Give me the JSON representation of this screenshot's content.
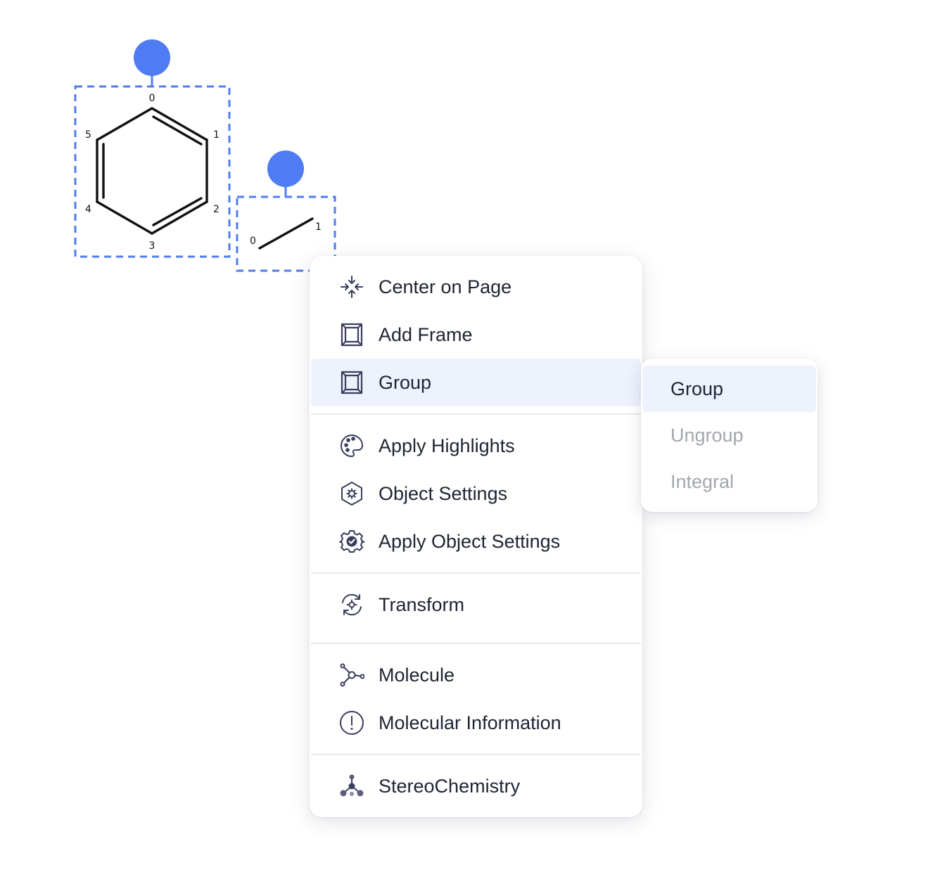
{
  "canvas": {
    "selection_color": "#4f7cf2",
    "molecule_1": {
      "atom_labels": [
        "0",
        "1",
        "2",
        "3",
        "4",
        "5"
      ]
    },
    "molecule_2": {
      "atom_labels": [
        "0",
        "1"
      ]
    }
  },
  "context_menu": {
    "items": [
      {
        "label": "Center on Page",
        "icon": "center-arrows-icon"
      },
      {
        "label": "Add Frame",
        "icon": "frame-icon"
      },
      {
        "label": "Group",
        "icon": "frame-icon",
        "active": true
      },
      {
        "label": "Apply Highlights",
        "icon": "palette-icon"
      },
      {
        "label": "Object Settings",
        "icon": "hexagon-gear-icon"
      },
      {
        "label": "Apply Object Settings",
        "icon": "gear-check-icon"
      },
      {
        "label": "Transform",
        "icon": "transform-cycle-icon"
      },
      {
        "label": "Molecule",
        "icon": "molecule-icon"
      },
      {
        "label": "Molecular Information",
        "icon": "info-circle-icon"
      },
      {
        "label": "StereoChemistry",
        "icon": "stereo-molecule-icon"
      }
    ]
  },
  "submenu": {
    "items": [
      {
        "label": "Group",
        "active": true,
        "enabled": true
      },
      {
        "label": "Ungroup",
        "enabled": false
      },
      {
        "label": "Integral",
        "enabled": false
      }
    ]
  },
  "colors": {
    "text": "#1f2333",
    "disabled_text": "#a3a6ae",
    "active_bg": "#eef2fd",
    "icon": "#3a3d5c"
  }
}
